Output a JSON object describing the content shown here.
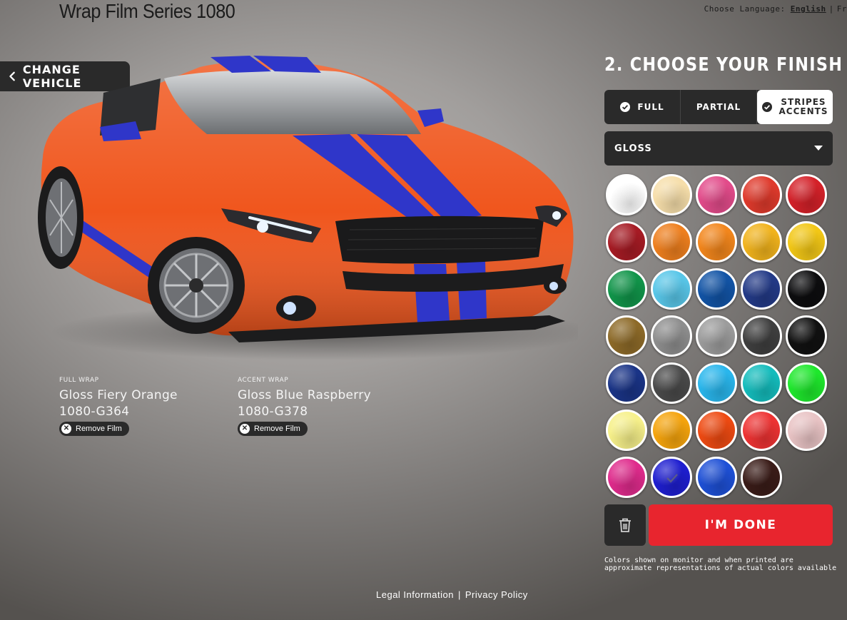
{
  "header": {
    "title": "Wrap Film Series 1080",
    "language_prompt": "Choose Language:",
    "language_current": "English",
    "language_next": "Fr"
  },
  "vehicle": {
    "change_label": "CHANGE VEHICLE",
    "body_color": "#f0561d",
    "stripe_color": "#2f36c9"
  },
  "films": [
    {
      "kind": "FULL WRAP",
      "name": "Gloss Fiery Orange",
      "code": "1080-G364",
      "remove_label": "Remove Film"
    },
    {
      "kind": "ACCENT WRAP",
      "name": "Gloss Blue Raspberry",
      "code": "1080-G378",
      "remove_label": "Remove Film"
    }
  ],
  "panel": {
    "title": "2. CHOOSE YOUR FINISH",
    "tabs": [
      {
        "label": "FULL",
        "checked": true,
        "active": false
      },
      {
        "label": "PARTIAL",
        "checked": false,
        "active": false
      },
      {
        "label_line1": "STRIPES",
        "label_line2": "ACCENTS",
        "checked": true,
        "active": true
      }
    ],
    "finish": "GLOSS",
    "swatches": [
      "#ffffff",
      "#f6deaa",
      "#e24b8a",
      "#df3a2c",
      "#d42129",
      "#a61b24",
      "#ee7f1e",
      "#f2861c",
      "#f1b31c",
      "#f2c716",
      "#11954a",
      "#58c6e8",
      "#1254a6",
      "#233a87",
      "#0d0d0f",
      "#8d6a28",
      "#8e8e8e",
      "#9c9c9c",
      "#3f3f3f",
      "#111111",
      "#1a3487",
      "#4a4a4a",
      "#29b6ec",
      "#14bcbc",
      "#1ee82c",
      "#f6f08a",
      "#f5a40d",
      "#ee4a12",
      "#ee3333",
      "#e8c3c4",
      "#df2b8c",
      "#1e1ed0",
      "#1e50d6",
      "#3a1c18"
    ],
    "selected_swatch_index": 31,
    "done_label": "I'M DONE",
    "disclaimer": "Colors shown on monitor and when printed are approximate representations of actual colors available"
  },
  "footer": {
    "legal": "Legal Information",
    "privacy": "Privacy Policy",
    "separator": "|"
  }
}
